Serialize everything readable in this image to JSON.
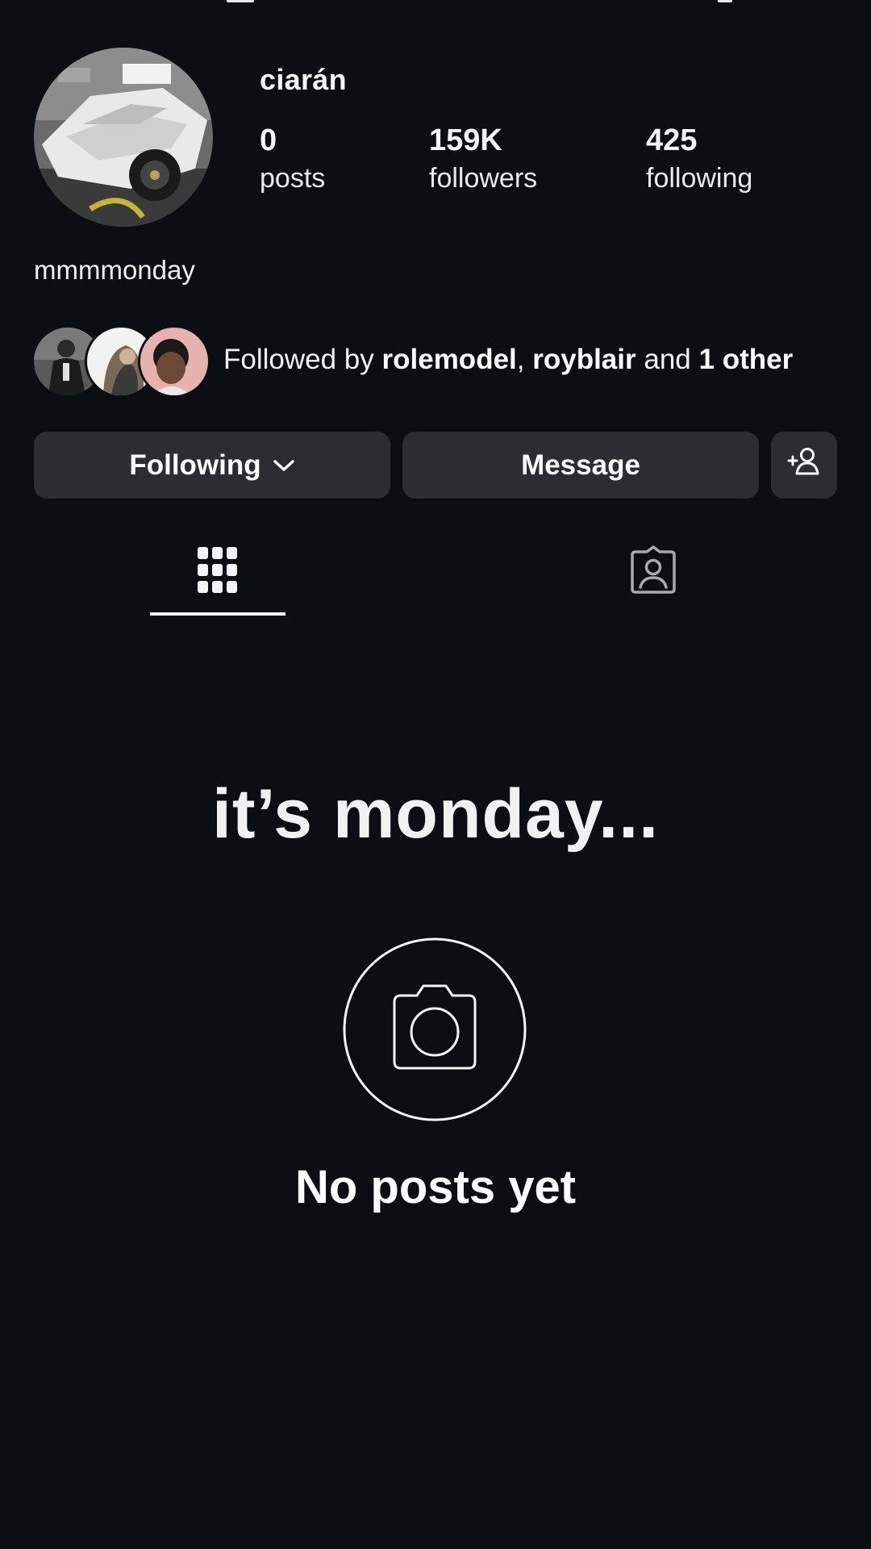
{
  "profile": {
    "username": "ciarán",
    "bio": "mmmmonday",
    "caption": "it’s monday...",
    "stats": [
      {
        "value": "0",
        "label": "posts"
      },
      {
        "value": "159K",
        "label": "followers"
      },
      {
        "value": "425",
        "label": "following"
      }
    ]
  },
  "followed_by": {
    "prefix": "Followed by",
    "user1": "rolemodel",
    "separator": ",",
    "user2": "royblair",
    "conjunction": "and",
    "others": "1 other"
  },
  "buttons": {
    "following": "Following",
    "message": "Message"
  },
  "tabs": [
    {
      "name": "posts-grid",
      "icon": "grid-icon",
      "active": true
    },
    {
      "name": "tagged",
      "icon": "tagged-person-icon",
      "active": false
    }
  ],
  "empty_state": {
    "title": "No posts yet",
    "icon": "camera-icon"
  },
  "colors": {
    "background": "#0b0f13",
    "button": "#2a2e33",
    "text": "#ffffff"
  }
}
